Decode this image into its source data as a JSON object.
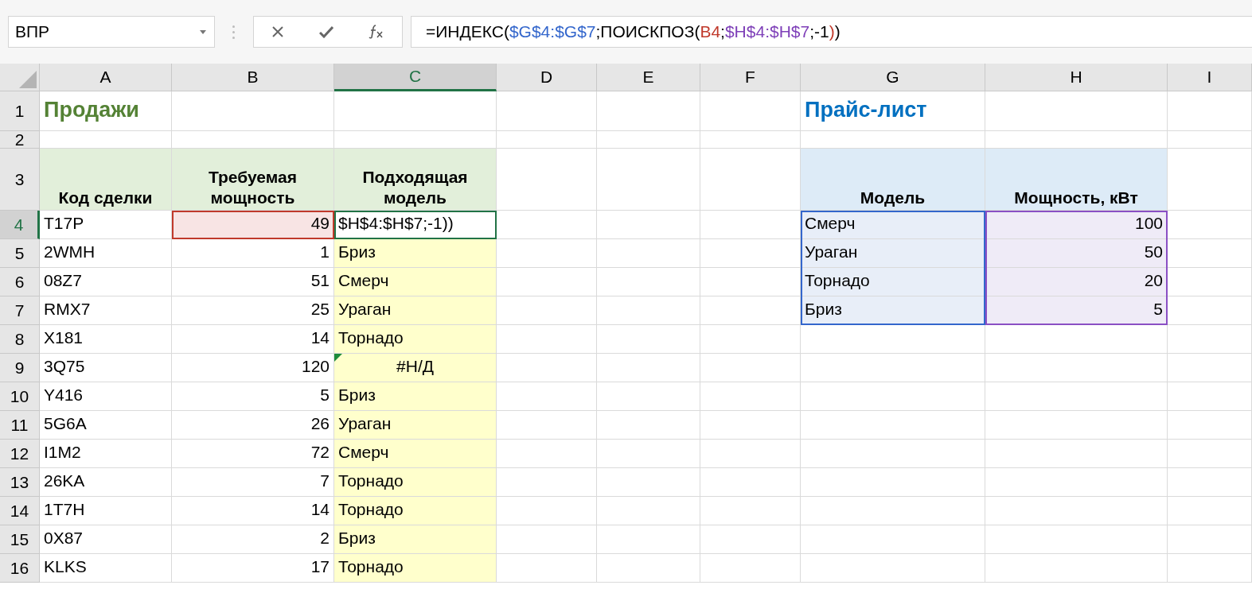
{
  "name_box": "ВПР",
  "formula": [
    {
      "text": "=ИНДЕКС(",
      "color": "#000000"
    },
    {
      "text": "$G$4:$G$7",
      "color": "#3366cc"
    },
    {
      "text": ";ПОИСКПОЗ(",
      "color": "#000000"
    },
    {
      "text": "B4",
      "color": "#c0392b"
    },
    {
      "text": ";",
      "color": "#000000"
    },
    {
      "text": "$H$4:$H$7",
      "color": "#7e3fb8"
    },
    {
      "text": ";-1",
      "color": "#000000"
    },
    {
      "text": ")",
      "color": "#c0392b"
    },
    {
      "text": ")",
      "color": "#000000"
    }
  ],
  "columns": [
    {
      "label": "A",
      "selected": false
    },
    {
      "label": "B",
      "selected": false
    },
    {
      "label": "C",
      "selected": true
    },
    {
      "label": "D",
      "selected": false
    },
    {
      "label": "E",
      "selected": false
    },
    {
      "label": "F",
      "selected": false
    },
    {
      "label": "G",
      "selected": false
    },
    {
      "label": "H",
      "selected": false
    },
    {
      "label": "I",
      "selected": false
    }
  ],
  "rows": [
    {
      "label": "1",
      "selected": false
    },
    {
      "label": "2",
      "selected": false
    },
    {
      "label": "3",
      "selected": false
    },
    {
      "label": "4",
      "selected": true
    },
    {
      "label": "5",
      "selected": false
    },
    {
      "label": "6",
      "selected": false
    },
    {
      "label": "7",
      "selected": false
    },
    {
      "label": "8",
      "selected": false
    },
    {
      "label": "9",
      "selected": false
    },
    {
      "label": "10",
      "selected": false
    },
    {
      "label": "11",
      "selected": false
    },
    {
      "label": "12",
      "selected": false
    },
    {
      "label": "13",
      "selected": false
    },
    {
      "label": "14",
      "selected": false
    },
    {
      "label": "15",
      "selected": false
    },
    {
      "label": "16",
      "selected": false
    }
  ],
  "sales": {
    "title": "Продажи",
    "headers": [
      "Код сделки",
      "Требуемая мощность",
      "Подходящая модель"
    ],
    "rows": [
      {
        "code": "T17P",
        "power": "49",
        "model": "$H$4:$H$7;-1))",
        "kind": "editing"
      },
      {
        "code": "2WMH",
        "power": "1",
        "model": "Бриз",
        "kind": "value"
      },
      {
        "code": "08Z7",
        "power": "51",
        "model": "Смерч",
        "kind": "value"
      },
      {
        "code": "RMX7",
        "power": "25",
        "model": "Ураган",
        "kind": "value"
      },
      {
        "code": "X181",
        "power": "14",
        "model": "Торнадо",
        "kind": "value"
      },
      {
        "code": "3Q75",
        "power": "120",
        "model": "#Н/Д",
        "kind": "error"
      },
      {
        "code": "Y416",
        "power": "5",
        "model": "Бриз",
        "kind": "value"
      },
      {
        "code": "5G6A",
        "power": "26",
        "model": "Ураган",
        "kind": "value"
      },
      {
        "code": "I1M2",
        "power": "72",
        "model": "Смерч",
        "kind": "value"
      },
      {
        "code": "26KA",
        "power": "7",
        "model": "Торнадо",
        "kind": "value"
      },
      {
        "code": "1T7H",
        "power": "14",
        "model": "Торнадо",
        "kind": "value"
      },
      {
        "code": "0X87",
        "power": "2",
        "model": "Бриз",
        "kind": "value"
      },
      {
        "code": "KLKS",
        "power": "17",
        "model": "Торнадо",
        "kind": "value"
      }
    ]
  },
  "price": {
    "title": "Прайс-лист",
    "headers": [
      "Модель",
      "Мощность, кВт"
    ],
    "rows": [
      {
        "model": "Смерч",
        "power": "100"
      },
      {
        "model": "Ураган",
        "power": "50"
      },
      {
        "model": "Торнадо",
        "power": "20"
      },
      {
        "model": "Бриз",
        "power": "5"
      }
    ]
  }
}
